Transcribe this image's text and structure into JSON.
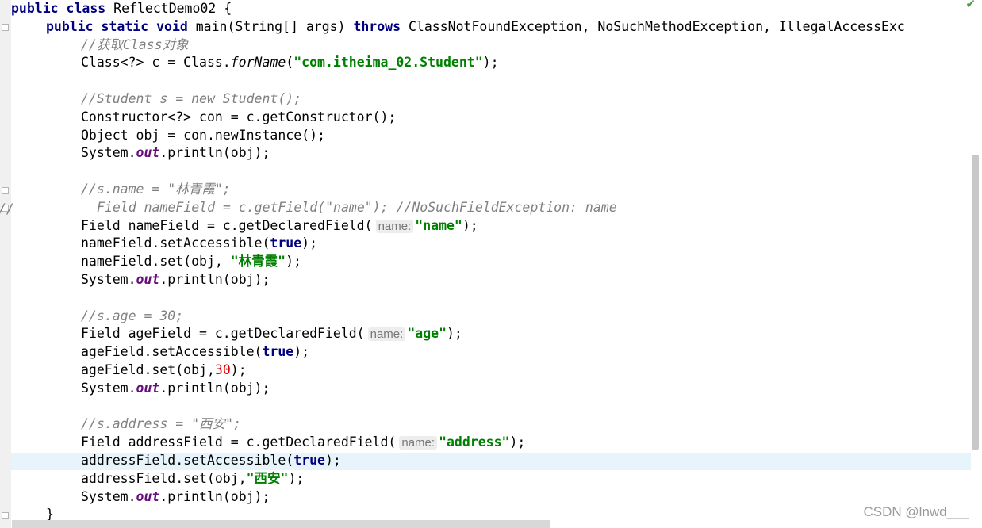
{
  "editor": {
    "lines": [
      [
        {
          "t": "public class",
          "c": "kw"
        },
        {
          "t": " ReflectDemo02 {"
        }
      ],
      [
        {
          "t": "public static void",
          "c": "kw"
        },
        {
          "t": " main(String[] args) "
        },
        {
          "t": "throws",
          "c": "kw"
        },
        {
          "t": " ClassNotFoundException, NoSuchMethodException, IllegalAccessExc"
        }
      ],
      [
        {
          "t": "//获取Class对象",
          "c": "cmt"
        }
      ],
      [
        {
          "t": "Class<?> c = Class."
        },
        {
          "t": "forName",
          "c": "mth"
        },
        {
          "t": "("
        },
        {
          "t": "\"com.itheima_02.Student\"",
          "c": "str"
        },
        {
          "t": ");"
        }
      ],
      [],
      [
        {
          "t": "//Student s = new Student();",
          "c": "cmt"
        }
      ],
      [
        {
          "t": "Constructor<?> con = c.getConstructor();"
        }
      ],
      [
        {
          "t": "Object obj = con.newInstance();"
        }
      ],
      [
        {
          "t": "System."
        },
        {
          "t": "out",
          "c": "fld"
        },
        {
          "t": ".println(obj);"
        }
      ],
      [],
      [
        {
          "t": "//s.name = \"林青霞\";",
          "c": "cmt"
        }
      ],
      [
        {
          "t": "Field nameField = c.getField(\"name\"); //NoSuchFieldException: name",
          "c": "cmt"
        }
      ],
      [
        {
          "t": "Field nameField = c.getDeclaredField("
        },
        {
          "t": "name:",
          "c": "hint"
        },
        {
          "t": "\"name\"",
          "c": "str"
        },
        {
          "t": ");"
        }
      ],
      [
        {
          "t": "nameField.setAccessible("
        },
        {
          "t": "true",
          "c": "kw"
        },
        {
          "t": ");"
        }
      ],
      [
        {
          "t": "nameField.set(obj, "
        },
        {
          "t": "\"林青霞\"",
          "c": "str"
        },
        {
          "t": ");"
        }
      ],
      [
        {
          "t": "System."
        },
        {
          "t": "out",
          "c": "fld"
        },
        {
          "t": ".println(obj);"
        }
      ],
      [],
      [
        {
          "t": "//s.age = 30;",
          "c": "cmt"
        }
      ],
      [
        {
          "t": "Field ageField = c.getDeclaredField("
        },
        {
          "t": "name:",
          "c": "hint"
        },
        {
          "t": "\"age\"",
          "c": "str"
        },
        {
          "t": ");"
        }
      ],
      [
        {
          "t": "ageField.setAccessible("
        },
        {
          "t": "true",
          "c": "kw"
        },
        {
          "t": ");"
        }
      ],
      [
        {
          "t": "ageField.set(obj,"
        },
        {
          "t": "30",
          "c": "num"
        },
        {
          "t": ");"
        }
      ],
      [
        {
          "t": "System."
        },
        {
          "t": "out",
          "c": "fld"
        },
        {
          "t": ".println(obj);"
        }
      ],
      [],
      [
        {
          "t": "//s.address = \"西安\";",
          "c": "cmt"
        }
      ],
      [
        {
          "t": "Field addressField = c.getDeclaredField("
        },
        {
          "t": "name:",
          "c": "hint"
        },
        {
          "t": "\"address\"",
          "c": "str"
        },
        {
          "t": ");"
        }
      ],
      [
        {
          "t": "addressField.setAccessible("
        },
        {
          "t": "true",
          "c": "kw"
        },
        {
          "t": ");"
        }
      ],
      [
        {
          "t": "addressField.set(obj,"
        },
        {
          "t": "\"西安\"",
          "c": "str"
        },
        {
          "t": ");"
        }
      ],
      [
        {
          "t": "System."
        },
        {
          "t": "out",
          "c": "fld"
        },
        {
          "t": ".println(obj);"
        }
      ],
      [
        {
          "t": "}"
        }
      ]
    ],
    "indent": [
      0,
      1,
      2,
      2,
      0,
      2,
      2,
      2,
      2,
      0,
      2,
      2,
      2,
      2,
      2,
      2,
      0,
      2,
      2,
      2,
      2,
      2,
      0,
      2,
      2,
      2,
      2,
      2,
      1
    ],
    "comment_prefix": "//"
  },
  "watermark": "CSDN @lnwd___",
  "status_icon": "check-icon"
}
